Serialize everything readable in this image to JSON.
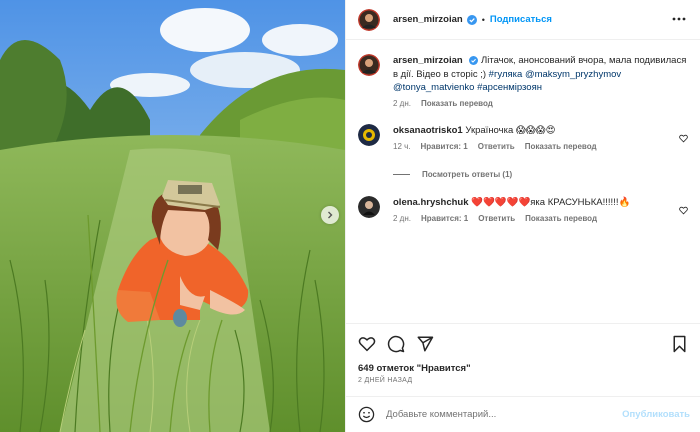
{
  "header": {
    "username": "arsen_mirzoian",
    "follow_label": "Подписаться",
    "dot": "•"
  },
  "caption": {
    "username": "arsen_mirzoian",
    "text": "Літачок, анонсований вчора, мала подивилася в дії. Відео в сторіс ;)",
    "hashtag1": "#гуляка",
    "mention1": "@maksym_pryzhymov",
    "mention2": "@tonya_matvienko",
    "hashtag2": "#арсенмірзоян",
    "time": "2 дн.",
    "translate": "Показать перевод"
  },
  "comments": [
    {
      "username": "oksanaotrisko1",
      "text": "Україночка 😱😱😱😍",
      "time": "12 ч.",
      "likes": "Нравится: 1",
      "reply": "Ответить",
      "translate": "Показать перевод",
      "view_replies": "Посмотреть ответы (1)"
    },
    {
      "username": "olena.hryshchuk",
      "text": "❤️❤️❤️❤️❤️яка КРАСУНЬКА!!!!!!🔥",
      "time": "2 дн.",
      "likes": "Нравится: 1",
      "reply": "Ответить",
      "translate": "Показать перевод"
    }
  ],
  "post_stats": {
    "likes": "649 отметок \"Нравится\"",
    "date": "2 ДНЕЙ НАЗАД"
  },
  "composer": {
    "placeholder": "Добавьте комментарий...",
    "publish_label": "Опубликовать"
  },
  "icons": {
    "like": "heart-icon",
    "comment": "comment-icon",
    "share": "share-icon",
    "save": "bookmark-icon",
    "more": "more-icon",
    "emoji": "emoji-icon",
    "next": "chevron-right-icon"
  },
  "colors": {
    "accent": "#0095f6",
    "verified": "#3897f0",
    "muted": "#737373",
    "publish_disabled": "#b2dffc"
  }
}
